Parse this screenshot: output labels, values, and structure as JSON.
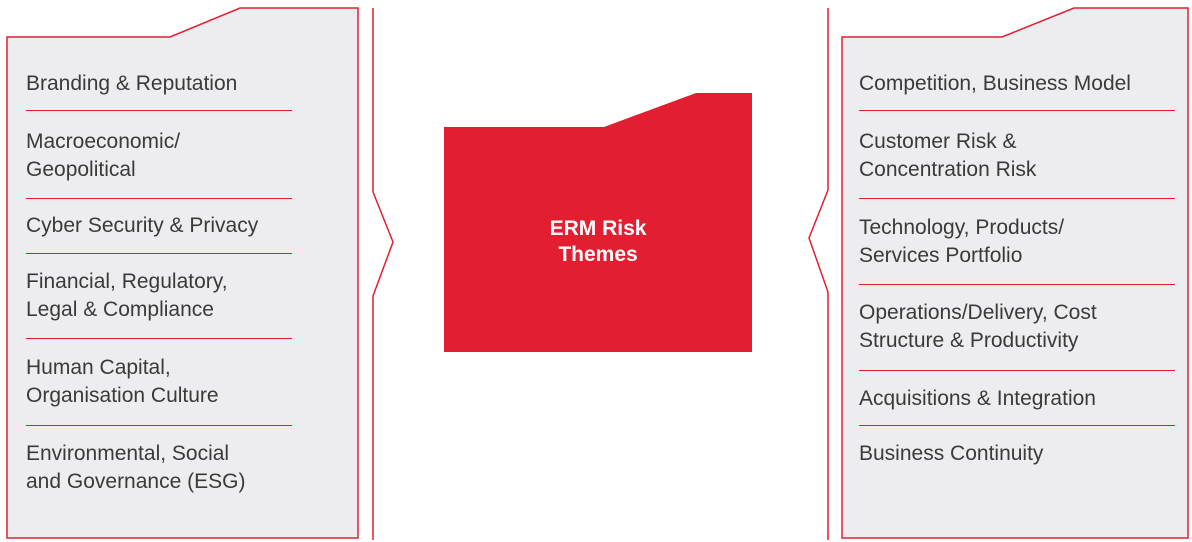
{
  "colors": {
    "accent": "#e41e31",
    "panel": "#ededef",
    "text": "#3a3a3a"
  },
  "center": {
    "line1": "ERM Risk",
    "line2": "Themes"
  },
  "left_panel": {
    "items": [
      {
        "lines": [
          "Branding & Reputation"
        ]
      },
      {
        "lines": [
          "Macroeconomic/",
          "Geopolitical"
        ]
      },
      {
        "lines": [
          "Cyber Security & Privacy"
        ]
      },
      {
        "lines": [
          "Financial, Regulatory,",
          "Legal & Compliance"
        ]
      },
      {
        "lines": [
          "Human Capital,",
          "Organisation Culture"
        ]
      },
      {
        "lines": [
          "Environmental, Social",
          "and Governance (ESG)"
        ]
      }
    ]
  },
  "right_panel": {
    "items": [
      {
        "lines": [
          "Competition, Business Model"
        ]
      },
      {
        "lines": [
          "Customer Risk &",
          "Concentration Risk"
        ]
      },
      {
        "lines": [
          "Technology, Products/",
          "Services Portfolio"
        ]
      },
      {
        "lines": [
          "Operations/Delivery, Cost",
          "Structure & Productivity"
        ]
      },
      {
        "lines": [
          "Acquisitions & Integration"
        ]
      },
      {
        "lines": [
          "Business Continuity"
        ]
      }
    ]
  }
}
